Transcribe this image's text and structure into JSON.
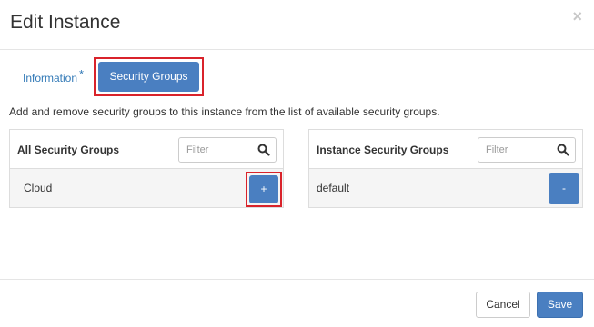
{
  "modal": {
    "title": "Edit Instance",
    "close_symbol": "×"
  },
  "tabs": [
    {
      "label": "Information",
      "required_marker": "*",
      "active": false
    },
    {
      "label": "Security Groups",
      "active": true
    }
  ],
  "help_text": "Add and remove security groups to this instance from the list of available security groups.",
  "all_groups": {
    "title": "All Security Groups",
    "filter_placeholder": "Filter",
    "items": [
      {
        "name": "Cloud",
        "action_label": "+"
      }
    ]
  },
  "instance_groups": {
    "title": "Instance Security Groups",
    "filter_placeholder": "Filter",
    "items": [
      {
        "name": "default",
        "action_label": "-"
      }
    ]
  },
  "footer": {
    "cancel_label": "Cancel",
    "save_label": "Save"
  },
  "colors": {
    "primary": "#4a7fc1",
    "highlight": "#d9232b",
    "link": "#337ab7"
  },
  "icons": {
    "close": "close-icon",
    "search": "search-icon"
  }
}
